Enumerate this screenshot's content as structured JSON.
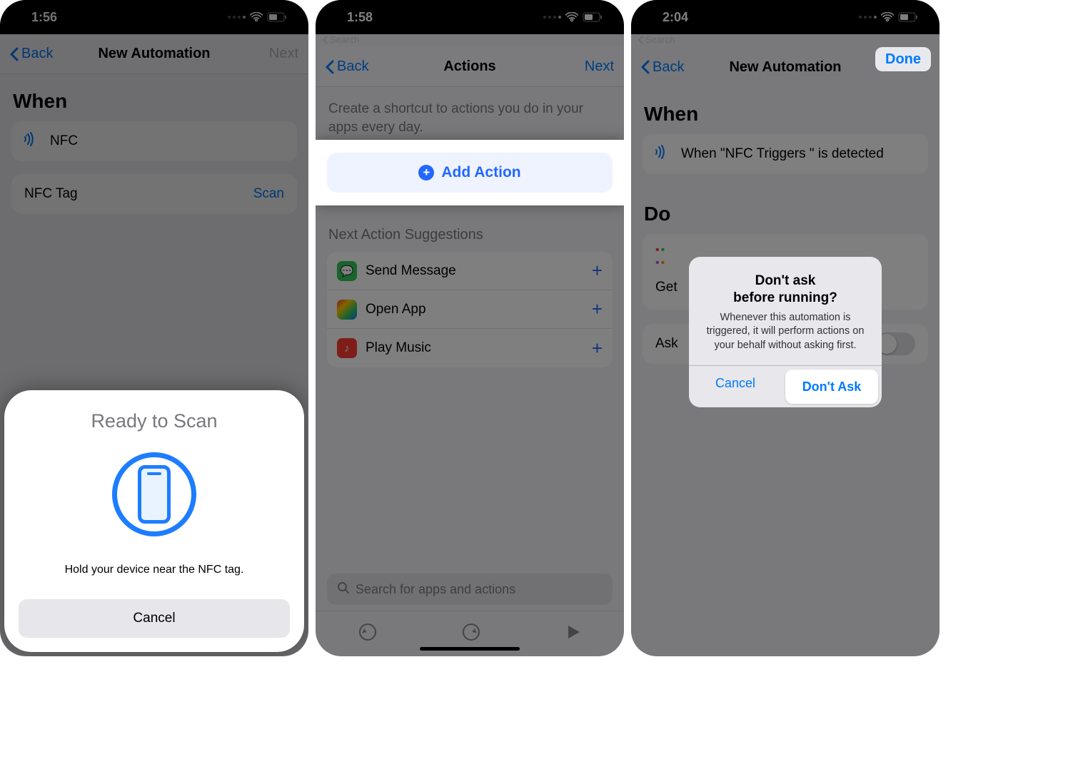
{
  "panel1": {
    "status_time": "1:56",
    "nav_back": "Back",
    "nav_title": "New Automation",
    "nav_next": "Next",
    "section_when": "When",
    "nfc_label": "NFC",
    "nfctag_label": "NFC Tag",
    "scan_action": "Scan",
    "sheet_title": "Ready to Scan",
    "sheet_msg": "Hold your device near the NFC tag.",
    "sheet_cancel": "Cancel"
  },
  "panel2": {
    "status_time": "1:58",
    "status_back": "Search",
    "nav_back": "Back",
    "nav_title": "Actions",
    "nav_next": "Next",
    "desc": "Create a shortcut to actions you do in your apps every day.",
    "add_action": "Add Action",
    "sugg_label": "Next Action Suggestions",
    "suggestions": [
      {
        "label": "Send Message",
        "icon": "messages-icon"
      },
      {
        "label": "Open App",
        "icon": "apps-icon"
      },
      {
        "label": "Play Music",
        "icon": "music-icon"
      }
    ],
    "search_placeholder": "Search for apps and actions"
  },
  "panel3": {
    "status_time": "2:04",
    "status_back": "Search",
    "nav_back": "Back",
    "nav_title": "New Automation",
    "nav_done": "Done",
    "section_when": "When",
    "when_text": "When \"NFC Triggers \" is detected",
    "section_do": "Do",
    "do_get": "Get",
    "ask_label": "Ask",
    "alert_title": "Don't ask\nbefore running?",
    "alert_msg": "Whenever this automation is triggered, it will perform actions on your behalf without asking first.",
    "alert_cancel": "Cancel",
    "alert_confirm": "Don't Ask"
  }
}
